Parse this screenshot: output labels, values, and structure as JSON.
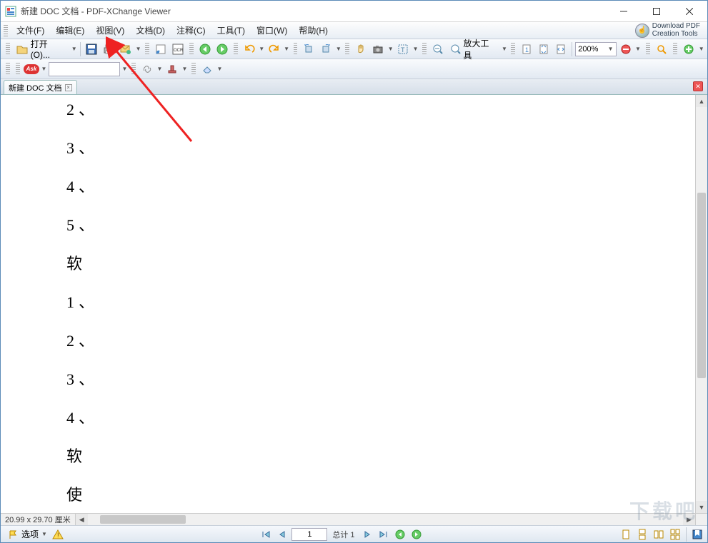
{
  "app": {
    "title": "新建 DOC 文档 - PDF-XChange Viewer"
  },
  "menu": {
    "file": "文件(F)",
    "edit": "编辑(E)",
    "view": "视图(V)",
    "document": "文档(D)",
    "comment": "注释(C)",
    "tool": "工具(T)",
    "window": "窗口(W)",
    "help": "帮助(H)",
    "download_line1": "Download PDF",
    "download_line2": "Creation Tools"
  },
  "toolbar1": {
    "open_label": "打开(O)...",
    "zoom_tool_label": "放大工具",
    "zoom_value": "200%"
  },
  "toolbar2": {
    "ask_label": "Ask"
  },
  "tab": {
    "label": "新建 DOC 文档"
  },
  "doc": {
    "lines": [
      "2、",
      "3、",
      "4、",
      "5、",
      "软",
      "1、",
      "2、",
      "3、",
      "4、",
      "软",
      "使"
    ]
  },
  "hscroll": {
    "dims": "20.99 x 29.70 厘米"
  },
  "status": {
    "options_label": "选项",
    "page_current": "1",
    "total_label": "总计 1"
  },
  "watermark": "下载吧"
}
